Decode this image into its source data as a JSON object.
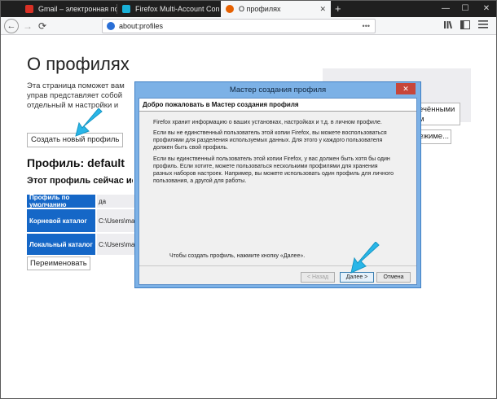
{
  "tabs": [
    {
      "label": "Gmail – электронная почта и",
      "favicon_color": "#d93025"
    },
    {
      "label": "Firefox Multi-Account Contain",
      "favicon_color": "#18b0d8"
    },
    {
      "label": "О профилях",
      "favicon_color": "#e66000"
    }
  ],
  "tab_close": "✕",
  "new_tab": "+",
  "window_controls": {
    "minimize": "—",
    "maximize": "☐",
    "close": "✕"
  },
  "nav": {
    "back": "←",
    "forward": "→",
    "reload": "⟳",
    "url": "about:profiles",
    "url_more": "•••",
    "icons": [
      "library-icon",
      "sidebar-icon",
      "menu-icon"
    ]
  },
  "page": {
    "title": "О профилях",
    "description": "Эта страница поможет вам управ представляет собой отдельный м настройки и дополнения.",
    "create_button": "Создать новый профиль",
    "profile_heading": "Профиль: default",
    "in_use_heading": "Этот профиль сейчас испол",
    "table": [
      {
        "key": "Профиль по умолчанию",
        "value": "да"
      },
      {
        "key": "Корневой каталог",
        "value": "C:\\Users\\madr"
      },
      {
        "key": "Локальный каталог",
        "value": "C:\\Users\\madr"
      }
    ],
    "rename_button": "Переименовать",
    "right_button_1": "ечёнными м",
    "right_button_2": "режиме..."
  },
  "dialog": {
    "title": "Мастер создания профиля",
    "close": "✕",
    "header": "Добро пожаловать в Мастер создания профиля",
    "paragraphs": [
      "Firefox хранит информацию о ваших установках, настройках и т.д. в личном профиле.",
      "Если вы не единственный пользователь этой копии Firefox, вы можете воспользоваться профилями для разделения используемых данных. Для этого у каждого пользователя должен быть свой профиль.",
      "Если вы единственный пользователь этой копии Firefox, у вас должен быть хотя бы один профиль. Если хотите, можете пользоваться несколькими профилями для хранения разных наборов настроек. Например, вы можете использовать один профиль для личного пользования, а другой для работы."
    ],
    "footer_text": "Чтобы создать профиль, нажмите кнопку «Далее».",
    "back_button": "< Назад",
    "next_button": "Далее >",
    "cancel_button": "Отмена"
  },
  "colors": {
    "accent": "#1567c7",
    "dialog_frame": "#7cb1e6",
    "pointer_arrow": "#29b6e8"
  }
}
